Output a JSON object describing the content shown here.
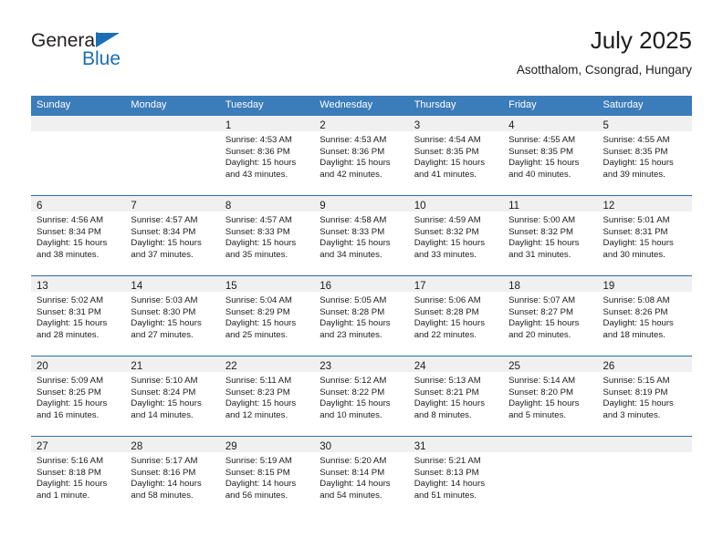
{
  "brand": {
    "name_part1": "General",
    "name_part2": "Blue",
    "triangle_color": "#1a6eb5"
  },
  "header": {
    "title": "July 2025",
    "subtitle": "Asotthalom, Csongrad, Hungary"
  },
  "colors": {
    "header_blue": "#3b7cba",
    "row_rule_blue": "#2e6da4",
    "daynum_band": "#f0f0f0",
    "text": "#1c1c1c"
  },
  "weekday_headers": [
    "Sunday",
    "Monday",
    "Tuesday",
    "Wednesday",
    "Thursday",
    "Friday",
    "Saturday"
  ],
  "weeks": [
    [
      {
        "day": "",
        "lines": []
      },
      {
        "day": "",
        "lines": []
      },
      {
        "day": "1",
        "lines": [
          "Sunrise: 4:53 AM",
          "Sunset: 8:36 PM",
          "Daylight: 15 hours",
          "and 43 minutes."
        ]
      },
      {
        "day": "2",
        "lines": [
          "Sunrise: 4:53 AM",
          "Sunset: 8:36 PM",
          "Daylight: 15 hours",
          "and 42 minutes."
        ]
      },
      {
        "day": "3",
        "lines": [
          "Sunrise: 4:54 AM",
          "Sunset: 8:35 PM",
          "Daylight: 15 hours",
          "and 41 minutes."
        ]
      },
      {
        "day": "4",
        "lines": [
          "Sunrise: 4:55 AM",
          "Sunset: 8:35 PM",
          "Daylight: 15 hours",
          "and 40 minutes."
        ]
      },
      {
        "day": "5",
        "lines": [
          "Sunrise: 4:55 AM",
          "Sunset: 8:35 PM",
          "Daylight: 15 hours",
          "and 39 minutes."
        ]
      }
    ],
    [
      {
        "day": "6",
        "lines": [
          "Sunrise: 4:56 AM",
          "Sunset: 8:34 PM",
          "Daylight: 15 hours",
          "and 38 minutes."
        ]
      },
      {
        "day": "7",
        "lines": [
          "Sunrise: 4:57 AM",
          "Sunset: 8:34 PM",
          "Daylight: 15 hours",
          "and 37 minutes."
        ]
      },
      {
        "day": "8",
        "lines": [
          "Sunrise: 4:57 AM",
          "Sunset: 8:33 PM",
          "Daylight: 15 hours",
          "and 35 minutes."
        ]
      },
      {
        "day": "9",
        "lines": [
          "Sunrise: 4:58 AM",
          "Sunset: 8:33 PM",
          "Daylight: 15 hours",
          "and 34 minutes."
        ]
      },
      {
        "day": "10",
        "lines": [
          "Sunrise: 4:59 AM",
          "Sunset: 8:32 PM",
          "Daylight: 15 hours",
          "and 33 minutes."
        ]
      },
      {
        "day": "11",
        "lines": [
          "Sunrise: 5:00 AM",
          "Sunset: 8:32 PM",
          "Daylight: 15 hours",
          "and 31 minutes."
        ]
      },
      {
        "day": "12",
        "lines": [
          "Sunrise: 5:01 AM",
          "Sunset: 8:31 PM",
          "Daylight: 15 hours",
          "and 30 minutes."
        ]
      }
    ],
    [
      {
        "day": "13",
        "lines": [
          "Sunrise: 5:02 AM",
          "Sunset: 8:31 PM",
          "Daylight: 15 hours",
          "and 28 minutes."
        ]
      },
      {
        "day": "14",
        "lines": [
          "Sunrise: 5:03 AM",
          "Sunset: 8:30 PM",
          "Daylight: 15 hours",
          "and 27 minutes."
        ]
      },
      {
        "day": "15",
        "lines": [
          "Sunrise: 5:04 AM",
          "Sunset: 8:29 PM",
          "Daylight: 15 hours",
          "and 25 minutes."
        ]
      },
      {
        "day": "16",
        "lines": [
          "Sunrise: 5:05 AM",
          "Sunset: 8:28 PM",
          "Daylight: 15 hours",
          "and 23 minutes."
        ]
      },
      {
        "day": "17",
        "lines": [
          "Sunrise: 5:06 AM",
          "Sunset: 8:28 PM",
          "Daylight: 15 hours",
          "and 22 minutes."
        ]
      },
      {
        "day": "18",
        "lines": [
          "Sunrise: 5:07 AM",
          "Sunset: 8:27 PM",
          "Daylight: 15 hours",
          "and 20 minutes."
        ]
      },
      {
        "day": "19",
        "lines": [
          "Sunrise: 5:08 AM",
          "Sunset: 8:26 PM",
          "Daylight: 15 hours",
          "and 18 minutes."
        ]
      }
    ],
    [
      {
        "day": "20",
        "lines": [
          "Sunrise: 5:09 AM",
          "Sunset: 8:25 PM",
          "Daylight: 15 hours",
          "and 16 minutes."
        ]
      },
      {
        "day": "21",
        "lines": [
          "Sunrise: 5:10 AM",
          "Sunset: 8:24 PM",
          "Daylight: 15 hours",
          "and 14 minutes."
        ]
      },
      {
        "day": "22",
        "lines": [
          "Sunrise: 5:11 AM",
          "Sunset: 8:23 PM",
          "Daylight: 15 hours",
          "and 12 minutes."
        ]
      },
      {
        "day": "23",
        "lines": [
          "Sunrise: 5:12 AM",
          "Sunset: 8:22 PM",
          "Daylight: 15 hours",
          "and 10 minutes."
        ]
      },
      {
        "day": "24",
        "lines": [
          "Sunrise: 5:13 AM",
          "Sunset: 8:21 PM",
          "Daylight: 15 hours",
          "and 8 minutes."
        ]
      },
      {
        "day": "25",
        "lines": [
          "Sunrise: 5:14 AM",
          "Sunset: 8:20 PM",
          "Daylight: 15 hours",
          "and 5 minutes."
        ]
      },
      {
        "day": "26",
        "lines": [
          "Sunrise: 5:15 AM",
          "Sunset: 8:19 PM",
          "Daylight: 15 hours",
          "and 3 minutes."
        ]
      }
    ],
    [
      {
        "day": "27",
        "lines": [
          "Sunrise: 5:16 AM",
          "Sunset: 8:18 PM",
          "Daylight: 15 hours",
          "and 1 minute."
        ]
      },
      {
        "day": "28",
        "lines": [
          "Sunrise: 5:17 AM",
          "Sunset: 8:16 PM",
          "Daylight: 14 hours",
          "and 58 minutes."
        ]
      },
      {
        "day": "29",
        "lines": [
          "Sunrise: 5:19 AM",
          "Sunset: 8:15 PM",
          "Daylight: 14 hours",
          "and 56 minutes."
        ]
      },
      {
        "day": "30",
        "lines": [
          "Sunrise: 5:20 AM",
          "Sunset: 8:14 PM",
          "Daylight: 14 hours",
          "and 54 minutes."
        ]
      },
      {
        "day": "31",
        "lines": [
          "Sunrise: 5:21 AM",
          "Sunset: 8:13 PM",
          "Daylight: 14 hours",
          "and 51 minutes."
        ]
      },
      {
        "day": "",
        "lines": []
      },
      {
        "day": "",
        "lines": []
      }
    ]
  ]
}
